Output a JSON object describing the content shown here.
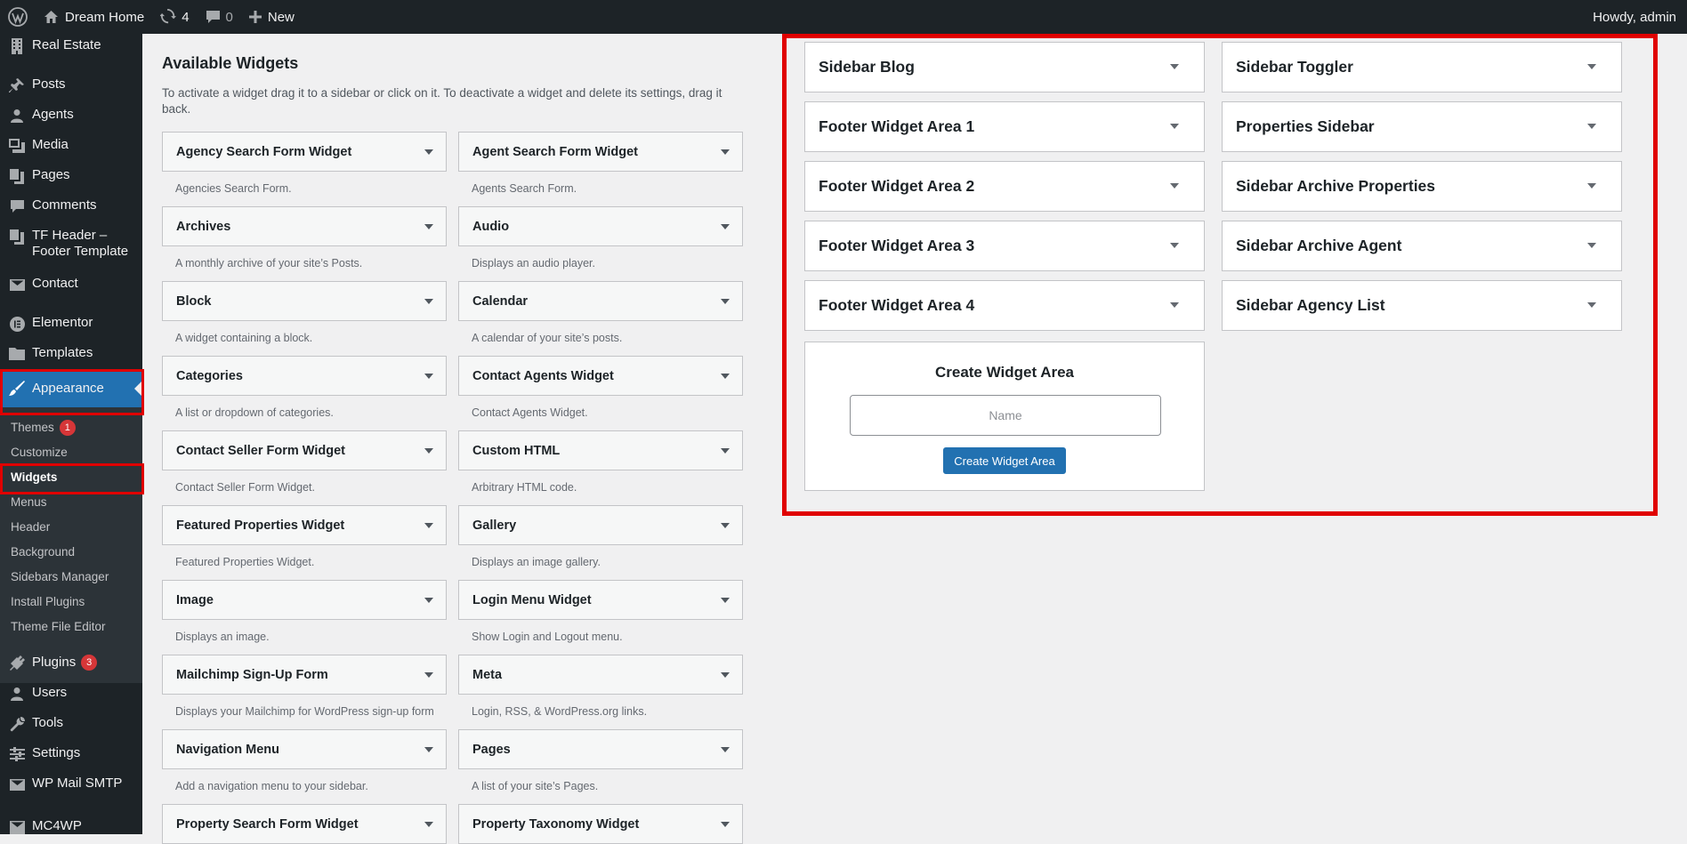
{
  "admin_bar": {
    "site_name": "Dream Home",
    "updates_count": "4",
    "comments_count": "0",
    "new_label": "New",
    "howdy": "Howdy, admin"
  },
  "menu": {
    "real_estate": "Real Estate",
    "posts": "Posts",
    "agents": "Agents",
    "media": "Media",
    "pages": "Pages",
    "comments": "Comments",
    "tf_header_1": "TF Header –",
    "tf_header_2": "Footer Template",
    "contact": "Contact",
    "elementor": "Elementor",
    "templates": "Templates",
    "appearance": "Appearance",
    "plugins": "Plugins",
    "plugins_badge": "3",
    "users": "Users",
    "tools": "Tools",
    "settings": "Settings",
    "wp_mail_smtp": "WP Mail SMTP",
    "mc4wp": "MC4WP"
  },
  "submenu": {
    "themes": "Themes",
    "themes_badge": "1",
    "customize": "Customize",
    "widgets": "Widgets",
    "menus": "Menus",
    "header": "Header",
    "background": "Background",
    "sidebars_manager": "Sidebars Manager",
    "install_plugins": "Install Plugins",
    "theme_file_editor": "Theme File Editor"
  },
  "available": {
    "title": "Available Widgets",
    "description": "To activate a widget drag it to a sidebar or click on it. To deactivate a widget and delete its settings, drag it back."
  },
  "widgets": [
    {
      "name": "Agency Search Form Widget",
      "desc": "Agencies Search Form."
    },
    {
      "name": "Agent Search Form Widget",
      "desc": "Agents Search Form."
    },
    {
      "name": "Archives",
      "desc": "A monthly archive of your site’s Posts."
    },
    {
      "name": "Audio",
      "desc": "Displays an audio player."
    },
    {
      "name": "Block",
      "desc": "A widget containing a block."
    },
    {
      "name": "Calendar",
      "desc": "A calendar of your site’s posts."
    },
    {
      "name": "Categories",
      "desc": "A list or dropdown of categories."
    },
    {
      "name": "Contact Agents Widget",
      "desc": "Contact Agents Widget."
    },
    {
      "name": "Contact Seller Form Widget",
      "desc": "Contact Seller Form Widget."
    },
    {
      "name": "Custom HTML",
      "desc": "Arbitrary HTML code."
    },
    {
      "name": "Featured Properties Widget",
      "desc": "Featured Properties Widget."
    },
    {
      "name": "Gallery",
      "desc": "Displays an image gallery."
    },
    {
      "name": "Image",
      "desc": "Displays an image."
    },
    {
      "name": "Login Menu Widget",
      "desc": "Show Login and Logout menu."
    },
    {
      "name": "Mailchimp Sign-Up Form",
      "desc": "Displays your Mailchimp for WordPress sign-up form"
    },
    {
      "name": "Meta",
      "desc": "Login, RSS, & WordPress.org links."
    },
    {
      "name": "Navigation Menu",
      "desc": "Add a navigation menu to your sidebar."
    },
    {
      "name": "Pages",
      "desc": "A list of your site’s Pages."
    },
    {
      "name": "Property Search Form Widget",
      "desc": ""
    },
    {
      "name": "Property Taxonomy Widget",
      "desc": ""
    }
  ],
  "sidebars": [
    "Sidebar Blog",
    "Sidebar Toggler",
    "Footer Widget Area 1",
    "Properties Sidebar",
    "Footer Widget Area 2",
    "Sidebar Archive Properties",
    "Footer Widget Area 3",
    "Sidebar Archive Agent",
    "Footer Widget Area 4",
    "Sidebar Agency List"
  ],
  "create_area": {
    "title": "Create Widget Area",
    "placeholder": "Name",
    "button": "Create Widget Area"
  },
  "colors": {
    "admin_dark": "#1d2327",
    "accent_blue": "#2271b1",
    "badge_red": "#d63638",
    "highlight_red": "#e00000"
  }
}
